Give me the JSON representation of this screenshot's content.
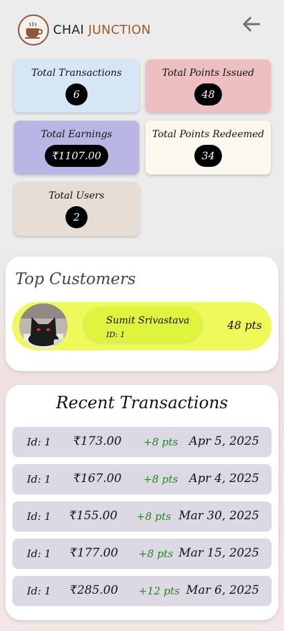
{
  "brand": {
    "name_part1": "CHAI",
    "name_part2": "JUNCTION"
  },
  "icons": {
    "logo": "coffee-cup-icon",
    "back": "arrow-left-icon"
  },
  "stats": {
    "total_transactions": {
      "label": "Total Transactions",
      "value": "6",
      "color": "#d7e6f6"
    },
    "total_points_issued": {
      "label": "Total Points Issued",
      "value": "48",
      "color": "#eebfc1"
    },
    "total_earnings": {
      "label": "Total Earnings",
      "value": "₹1107.00",
      "color": "#b9b6e6"
    },
    "total_points_redeemed": {
      "label": "Total Points Redeemed",
      "value": "34",
      "color": "#fdf8ee"
    },
    "total_users": {
      "label": "Total Users",
      "value": "2",
      "color": "#e6ddd4"
    }
  },
  "top_customers": {
    "title": "Top Customers",
    "items": [
      {
        "name": "Sumit Srivastava",
        "id_label": "ID: 1",
        "points": "48 pts"
      }
    ]
  },
  "recent_transactions": {
    "title": "Recent Transactions",
    "items": [
      {
        "id": "Id: 1",
        "amount": "₹173.00",
        "points": "+8 pts",
        "date": "Apr 5, 2025"
      },
      {
        "id": "Id: 1",
        "amount": "₹167.00",
        "points": "+8 pts",
        "date": "Apr 4, 2025"
      },
      {
        "id": "Id: 1",
        "amount": "₹155.00",
        "points": "+8 pts",
        "date": "Mar 30, 2025"
      },
      {
        "id": "Id: 1",
        "amount": "₹177.00",
        "points": "+8 pts",
        "date": "Mar 15, 2025"
      },
      {
        "id": "Id: 1",
        "amount": "₹285.00",
        "points": "+12 pts",
        "date": "Mar 6, 2025"
      }
    ]
  },
  "colors": {
    "accent_brown": "#9b5a2b",
    "positive_green": "#1e8a1e",
    "customer_highlight": "#eef95a"
  }
}
